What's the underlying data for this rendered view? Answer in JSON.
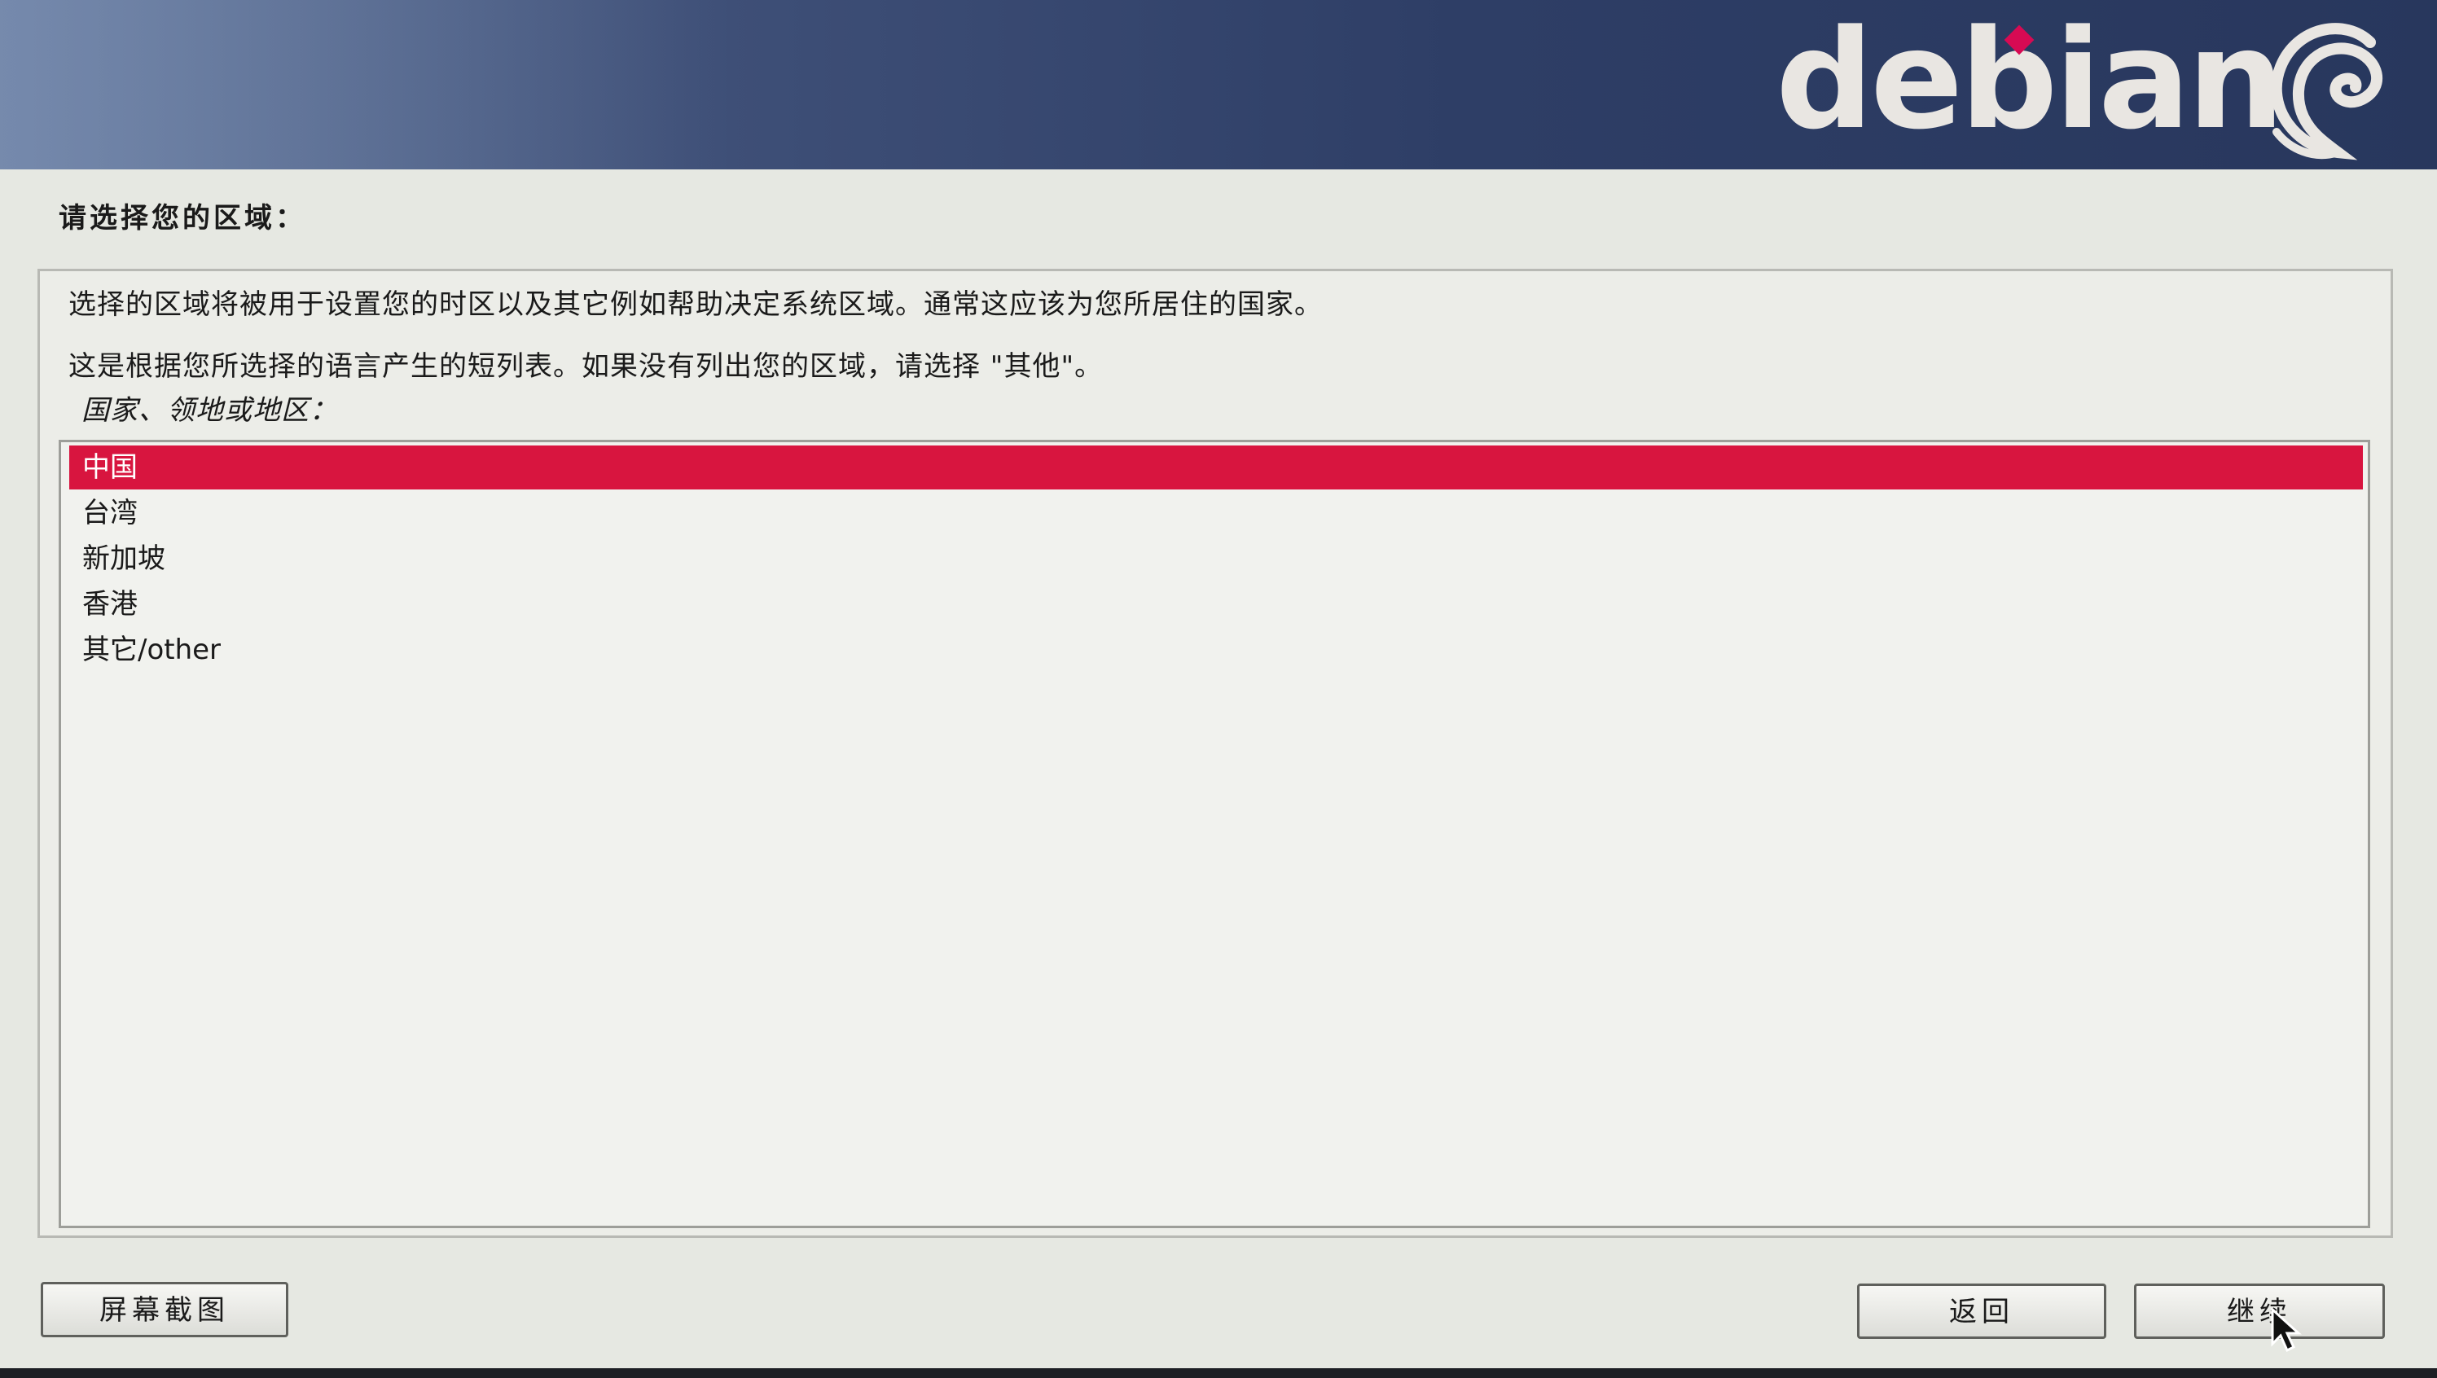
{
  "banner": {
    "logo_text": "debian",
    "logo_icon": "debian-swirl-icon"
  },
  "page": {
    "title": "请选择您的区域："
  },
  "content": {
    "description_line1": "选择的区域将被用于设置您的时区以及其它例如帮助决定系统区域。通常这应该为您所居住的国家。",
    "description_line2": "这是根据您所选择的语言产生的短列表。如果没有列出您的区域，请选择 \"其他\"。",
    "field_label": "国家、领地或地区："
  },
  "list": {
    "items": [
      {
        "label": "中国",
        "selected": true
      },
      {
        "label": "台湾",
        "selected": false
      },
      {
        "label": "新加坡",
        "selected": false
      },
      {
        "label": "香港",
        "selected": false
      },
      {
        "label": "其它/other",
        "selected": false
      }
    ]
  },
  "buttons": {
    "screenshot": "屏幕截图",
    "back": "返回",
    "continue": "继续"
  },
  "colors": {
    "banner": "#2e3e66",
    "selection": "#d8153f",
    "logo_accent": "#d70a53"
  }
}
